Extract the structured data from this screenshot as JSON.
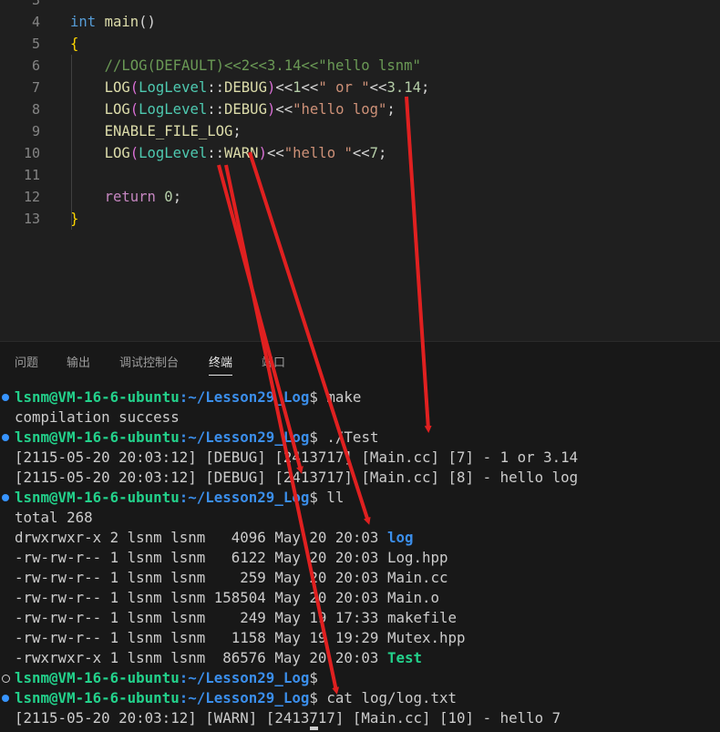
{
  "editor": {
    "lines": [
      {
        "n": "3",
        "tokens": []
      },
      {
        "n": "4",
        "tokens": [
          {
            "t": "int",
            "c": "kw"
          },
          {
            "t": " "
          },
          {
            "t": "main",
            "c": "fn"
          },
          {
            "t": "()",
            "c": "op"
          }
        ]
      },
      {
        "n": "5",
        "tokens": [
          {
            "t": "{",
            "c": "brace"
          }
        ]
      },
      {
        "n": "6",
        "tokens": [
          {
            "t": "    "
          },
          {
            "t": "//LOG(DEFAULT)<<2<<3.14<<\"hello lsnm\"",
            "c": "cmt"
          }
        ]
      },
      {
        "n": "7",
        "tokens": [
          {
            "t": "    "
          },
          {
            "t": "LOG",
            "c": "macro"
          },
          {
            "t": "(",
            "c": "paren"
          },
          {
            "t": "LogLevel",
            "c": "type"
          },
          {
            "t": "::",
            "c": "op"
          },
          {
            "t": "DEBUG",
            "c": "macro"
          },
          {
            "t": ")",
            "c": "paren"
          },
          {
            "t": "<<",
            "c": "op"
          },
          {
            "t": "1",
            "c": "num"
          },
          {
            "t": "<<",
            "c": "op"
          },
          {
            "t": "\" or \"",
            "c": "str"
          },
          {
            "t": "<<",
            "c": "op"
          },
          {
            "t": "3.14",
            "c": "num"
          },
          {
            "t": ";",
            "c": "op"
          }
        ]
      },
      {
        "n": "8",
        "tokens": [
          {
            "t": "    "
          },
          {
            "t": "LOG",
            "c": "macro"
          },
          {
            "t": "(",
            "c": "paren"
          },
          {
            "t": "LogLevel",
            "c": "type"
          },
          {
            "t": "::",
            "c": "op"
          },
          {
            "t": "DEBUG",
            "c": "macro"
          },
          {
            "t": ")",
            "c": "paren"
          },
          {
            "t": "<<",
            "c": "op"
          },
          {
            "t": "\"hello log\"",
            "c": "str"
          },
          {
            "t": ";",
            "c": "op"
          }
        ]
      },
      {
        "n": "9",
        "tokens": [
          {
            "t": "    "
          },
          {
            "t": "ENABLE_FILE_LOG",
            "c": "macro"
          },
          {
            "t": ";",
            "c": "op"
          }
        ]
      },
      {
        "n": "10",
        "tokens": [
          {
            "t": "    "
          },
          {
            "t": "LOG",
            "c": "macro"
          },
          {
            "t": "(",
            "c": "paren"
          },
          {
            "t": "LogLevel",
            "c": "type"
          },
          {
            "t": "::",
            "c": "op"
          },
          {
            "t": "WARN",
            "c": "macro"
          },
          {
            "t": ")",
            "c": "paren"
          },
          {
            "t": "<<",
            "c": "op"
          },
          {
            "t": "\"hello \"",
            "c": "str"
          },
          {
            "t": "<<",
            "c": "op"
          },
          {
            "t": "7",
            "c": "num"
          },
          {
            "t": ";",
            "c": "op"
          }
        ]
      },
      {
        "n": "11",
        "tokens": []
      },
      {
        "n": "12",
        "tokens": [
          {
            "t": "    "
          },
          {
            "t": "return",
            "c": "kwc"
          },
          {
            "t": " "
          },
          {
            "t": "0",
            "c": "num"
          },
          {
            "t": ";",
            "c": "op"
          }
        ]
      },
      {
        "n": "13",
        "tokens": [
          {
            "t": "}",
            "c": "brace"
          }
        ]
      }
    ]
  },
  "panel": {
    "tabs": [
      {
        "label": "问题",
        "active": false
      },
      {
        "label": "输出",
        "active": false
      },
      {
        "label": "调试控制台",
        "active": false
      },
      {
        "label": "终端",
        "active": true
      },
      {
        "label": "端口",
        "active": false
      }
    ]
  },
  "terminal": {
    "prompt_user": "lsnm@VM-16-6-ubuntu",
    "prompt_path": ":~/Lesson29_Log",
    "lines": [
      {
        "kind": "prompt",
        "dot": "blue",
        "cmd": "$ make"
      },
      {
        "kind": "out",
        "text": "compilation success"
      },
      {
        "kind": "prompt",
        "dot": "blue",
        "cmd": "$ ./Test"
      },
      {
        "kind": "out",
        "text": "[2115-05-20 20:03:12] [DEBUG] [2413717] [Main.cc] [7] - 1 or 3.14"
      },
      {
        "kind": "out",
        "text": "[2115-05-20 20:03:12] [DEBUG] [2413717] [Main.cc] [8] - hello log"
      },
      {
        "kind": "prompt",
        "dot": "blue",
        "cmd": "$ ll"
      },
      {
        "kind": "out",
        "text": "total 268"
      },
      {
        "kind": "ls",
        "pre": "drwxrwxr-x 2 lsnm lsnm   4096 May 20 20:03 ",
        "name": "log",
        "style": "dirc"
      },
      {
        "kind": "ls",
        "pre": "-rw-rw-r-- 1 lsnm lsnm   6122 May 20 20:03 ",
        "name": "Log.hpp",
        "style": ""
      },
      {
        "kind": "ls",
        "pre": "-rw-rw-r-- 1 lsnm lsnm    259 May 20 20:03 ",
        "name": "Main.cc",
        "style": ""
      },
      {
        "kind": "ls",
        "pre": "-rw-rw-r-- 1 lsnm lsnm 158504 May 20 20:03 ",
        "name": "Main.o",
        "style": ""
      },
      {
        "kind": "ls",
        "pre": "-rw-rw-r-- 1 lsnm lsnm    249 May 19 17:33 ",
        "name": "makefile",
        "style": ""
      },
      {
        "kind": "ls",
        "pre": "-rw-rw-r-- 1 lsnm lsnm   1158 May 19 19:29 ",
        "name": "Mutex.hpp",
        "style": ""
      },
      {
        "kind": "ls",
        "pre": "-rwxrwxr-x 1 lsnm lsnm  86576 May 20 20:03 ",
        "name": "Test",
        "style": "exec"
      },
      {
        "kind": "prompt",
        "dot": "hollow",
        "cmd": "$"
      },
      {
        "kind": "prompt",
        "dot": "blue",
        "cmd": "$ cat log/log.txt"
      },
      {
        "kind": "out",
        "text": "[2115-05-20 20:03:12] [WARN] [2413717] [Main.cc] [10] - hello 7"
      }
    ]
  },
  "colors": {
    "arrow": "#e02020",
    "editor_bg": "#1f1f1f",
    "panel_bg": "#181818"
  }
}
